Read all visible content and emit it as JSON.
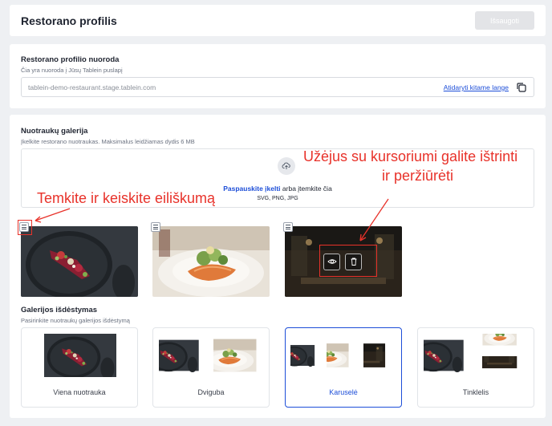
{
  "header": {
    "title": "Restorano profilis",
    "save_label": "Išsaugoti"
  },
  "link_section": {
    "title": "Restorano profilio nuoroda",
    "subtitle": "Čia yra nuoroda į Jūsų Tablein puslapį",
    "url": "tablein-demo-restaurant.stage.tablein.com",
    "open_label": "Atidaryti kitame lange",
    "copy_icon": "copy-icon"
  },
  "gallery": {
    "title": "Nuotraukų galerija",
    "subtitle": "Įkelkite restorano nuotraukas. Maksimalus leidžiamas dydis 6 MB",
    "upload_click": "Paspauskite įkelti",
    "upload_rest": " arba įtemkite čia",
    "upload_formats": "SVG, PNG, JPG",
    "upload_icon": "cloud-upload-icon",
    "photos": [
      {
        "subject": "beet salad on dark plate"
      },
      {
        "subject": "salmon with greens"
      },
      {
        "subject": "restaurant interior"
      }
    ],
    "overlay_icons": [
      "eye-icon",
      "trash-icon"
    ]
  },
  "layout_section": {
    "title": "Galerijos išdėstymas",
    "subtitle": "Pasirinkite nuotraukų galerijos išdėstymą",
    "options": [
      {
        "label": "Viena nuotrauka",
        "selected": false
      },
      {
        "label": "Dviguba",
        "selected": false
      },
      {
        "label": "Karuselė",
        "selected": true
      },
      {
        "label": "Tinklelis",
        "selected": false
      }
    ]
  },
  "annotations": {
    "reorder_note": "Temkite ir keiskite eiliškumą",
    "hover_note_line1": "Užėjus su kursoriumi galite ištrinti",
    "hover_note_line2": "ir peržiūrėti"
  },
  "colors": {
    "accent": "#1d4ed8",
    "annotation": "#e8322a",
    "disabled_button": "#e3e4e7"
  }
}
